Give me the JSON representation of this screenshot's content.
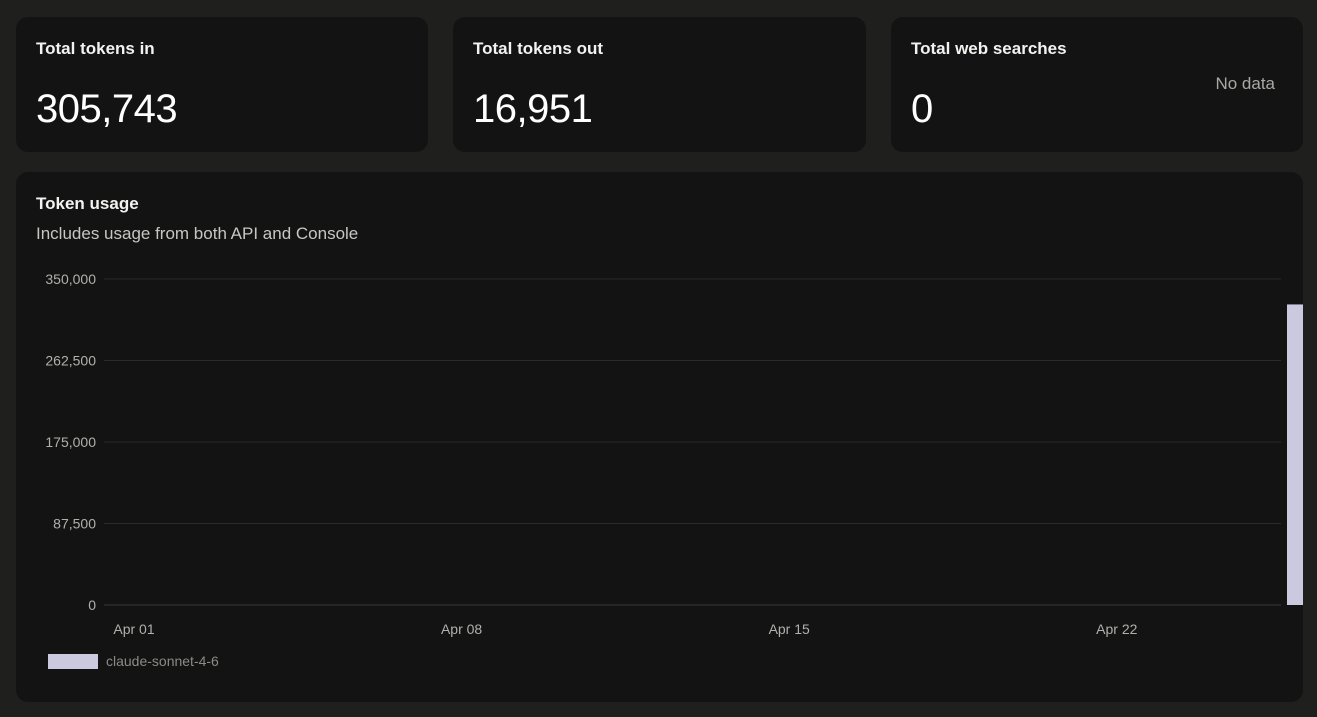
{
  "stats": {
    "tokens_in": {
      "label": "Total tokens in",
      "value": "305,743"
    },
    "tokens_out": {
      "label": "Total tokens out",
      "value": "16,951"
    },
    "web_searches": {
      "label": "Total web searches",
      "value": "0",
      "note": "No data"
    }
  },
  "chart": {
    "title": "Token usage",
    "subtitle": "Includes usage from both API and Console"
  },
  "chart_data": {
    "type": "bar",
    "title": "Token usage",
    "subtitle": "Includes usage from both API and Console",
    "xlabel": "",
    "ylabel": "",
    "ylim": [
      0,
      350000
    ],
    "yticks": [
      "350,000",
      "262,500",
      "175,000",
      "87,500",
      "0"
    ],
    "ytick_values": [
      350000,
      262500,
      175000,
      87500,
      0
    ],
    "xticks": [
      "Apr 01",
      "Apr 08",
      "Apr 15",
      "Apr 22"
    ],
    "categories": [
      "Apr 01",
      "Apr 02",
      "Apr 03",
      "Apr 04",
      "Apr 05",
      "Apr 06",
      "Apr 07",
      "Apr 08",
      "Apr 09",
      "Apr 10",
      "Apr 11",
      "Apr 12",
      "Apr 13",
      "Apr 14",
      "Apr 15",
      "Apr 16",
      "Apr 17",
      "Apr 18",
      "Apr 19",
      "Apr 20",
      "Apr 21",
      "Apr 22",
      "Apr 23",
      "Apr 24",
      "Apr 25",
      "Apr 26"
    ],
    "series": [
      {
        "name": "claude-sonnet-4-6",
        "color": "#cbc9df",
        "values": [
          0,
          0,
          0,
          0,
          0,
          0,
          0,
          0,
          0,
          0,
          0,
          0,
          0,
          0,
          0,
          0,
          0,
          0,
          0,
          0,
          0,
          0,
          0,
          0,
          0,
          322694
        ]
      }
    ],
    "grid": true,
    "legend": "bottom-left"
  }
}
